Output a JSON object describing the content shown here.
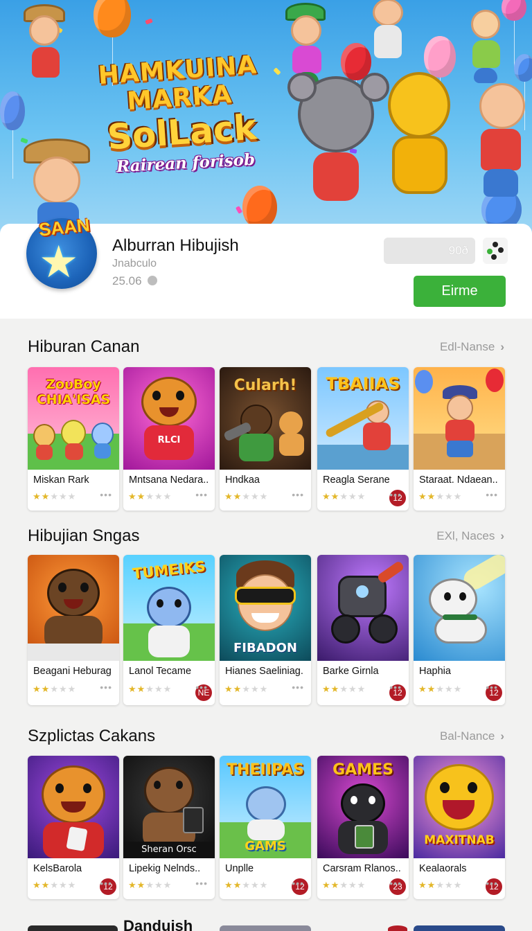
{
  "hero": {
    "title_line1": "HAMKUINA",
    "title_line2": "MARKA",
    "title_line3": "SolLack",
    "subtitle": "Rairean forisob"
  },
  "app": {
    "icon_badge": "SAAN",
    "title": "Alburran Hibujish",
    "developer": "Jnabculo",
    "meta": "25.06",
    "size_label": "90ð",
    "install_label": "Eirme"
  },
  "sections": [
    {
      "title": "Hiburan Canan",
      "see_all": "Edl-Nanse",
      "items": [
        {
          "name": "Miskan Rark",
          "art_text": "ZoυBoy CHIA'ISAS",
          "rating": 2
        },
        {
          "name": "Mntsana Nedara..",
          "art_text": "RLCI",
          "rating": 2
        },
        {
          "name": "Hndkaa",
          "art_text": "Cularh!",
          "rating": 2
        },
        {
          "name": "Reagla Serane",
          "art_text": "TBAIIAS",
          "rating": 2,
          "age": "12"
        },
        {
          "name": "Staraat. Ndaean..",
          "art_text": "",
          "rating": 2
        }
      ]
    },
    {
      "title": "Hibujian Sngas",
      "see_all": "EXl, Naces",
      "items": [
        {
          "name": "Beagani Heburag",
          "art_text": "",
          "rating": 2
        },
        {
          "name": "Lanol Tecame",
          "art_text": "TUMEIKS",
          "rating": 2,
          "age": "NE"
        },
        {
          "name": "Hianes Saeliniag.",
          "art_text": "FIBADON",
          "rating": 2
        },
        {
          "name": "Barke Girnla",
          "art_text": "",
          "rating": 2,
          "age": "12"
        },
        {
          "name": "Haphia",
          "art_text": "",
          "rating": 2,
          "age": "12"
        }
      ]
    },
    {
      "title": "Szplictas Cakans",
      "see_all": "Bal-Nance",
      "items": [
        {
          "name": "KelsBarola",
          "art_text": "",
          "rating": 2,
          "age": "12"
        },
        {
          "name": "Lipekig Nelnds..",
          "art_text": "Sheran Orsc",
          "rating": 2
        },
        {
          "name": "Unplle",
          "art_text": "THEIIPAS",
          "art_text2": "GAMS",
          "rating": 2,
          "age": "12"
        },
        {
          "name": "Carsram Rlanos..",
          "art_text": "GAMES",
          "rating": 2,
          "age": "23"
        },
        {
          "name": "Kealaorals",
          "art_text": "MAXITNAB",
          "rating": 2,
          "age": "12"
        }
      ]
    }
  ],
  "bottom_peek": {
    "title": "Dandujsh"
  },
  "colors": {
    "install_green": "#3bb13a",
    "star_gold": "#e3b72a",
    "age_badge_red": "#b31c26",
    "hero_sky": "#3aa0e6"
  },
  "icons": [
    "chevron-right-icon",
    "star-icon",
    "more-dots-icon",
    "share-icon",
    "info-icon"
  ]
}
